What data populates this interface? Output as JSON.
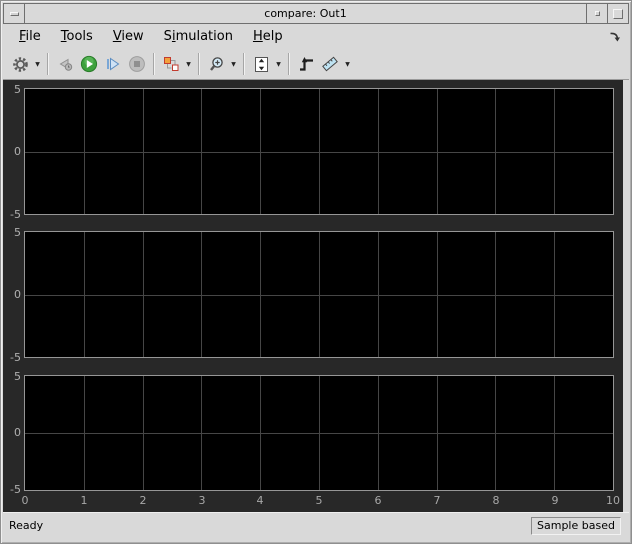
{
  "window": {
    "title": "compare: Out1"
  },
  "titlebar": {
    "buttons": [
      {
        "name": "window-menu",
        "icon": "dash-icon"
      },
      {
        "name": "minimize",
        "icon": "dot-icon"
      },
      {
        "name": "maximize",
        "icon": "square-icon"
      }
    ]
  },
  "menu": {
    "items": [
      {
        "label": "File",
        "pre": "",
        "u": "F",
        "post": "ile"
      },
      {
        "label": "Tools",
        "pre": "",
        "u": "T",
        "post": "ools"
      },
      {
        "label": "View",
        "pre": "",
        "u": "V",
        "post": "iew"
      },
      {
        "label": "Simulation",
        "pre": "S",
        "u": "i",
        "post": "mulation"
      },
      {
        "label": "Help",
        "pre": "",
        "u": "H",
        "post": "elp"
      }
    ],
    "dock_icon": "dock-arrow-icon"
  },
  "toolbar": {
    "buttons": [
      {
        "name": "settings",
        "icon": "gear-icon",
        "dropdown": true,
        "disabled": false
      },
      {
        "name": "step-back",
        "icon": "step-back-icon",
        "dropdown": false,
        "disabled": true
      },
      {
        "name": "run",
        "icon": "play-icon",
        "dropdown": false,
        "disabled": false
      },
      {
        "name": "step-forward",
        "icon": "step-forward-icon",
        "dropdown": false,
        "disabled": false
      },
      {
        "name": "stop",
        "icon": "stop-icon",
        "dropdown": false,
        "disabled": true
      },
      {
        "name": "signal-selector",
        "icon": "signal-selector-icon",
        "dropdown": true,
        "disabled": false
      },
      {
        "name": "zoom",
        "icon": "zoom-in-icon",
        "dropdown": true,
        "disabled": false
      },
      {
        "name": "fit-to-view",
        "icon": "fit-to-view-icon",
        "dropdown": true,
        "disabled": false
      },
      {
        "name": "trigger",
        "icon": "trigger-icon",
        "dropdown": false,
        "disabled": false
      },
      {
        "name": "cursor-measurements",
        "icon": "ruler-icon",
        "dropdown": true,
        "disabled": false
      }
    ]
  },
  "scope": {
    "x_ticks": [
      "0",
      "1",
      "2",
      "3",
      "4",
      "5",
      "6",
      "7",
      "8",
      "9",
      "10"
    ],
    "plots": [
      {
        "y_ticks": [
          "5",
          "0",
          "-5"
        ]
      },
      {
        "y_ticks": [
          "5",
          "0",
          "-5"
        ]
      },
      {
        "y_ticks": [
          "5",
          "0",
          "-5"
        ]
      }
    ],
    "colors": {
      "canvas": "#282828",
      "plot_background": "#000000",
      "grid": "#464646",
      "tick_label": "#b0b0b0",
      "axis_frame": "#969696",
      "play_green": "#3da13d",
      "step_blue": "#cfe2f5",
      "selector_orange": "#f2a13c"
    }
  },
  "statusbar": {
    "left": "Ready",
    "right": "Sample based"
  },
  "chart_data": [
    {
      "type": "line",
      "title": "",
      "xlabel": "",
      "ylabel": "",
      "x_range": [
        0,
        10
      ],
      "y_range": [
        -5,
        5
      ],
      "x_ticks": [
        0,
        1,
        2,
        3,
        4,
        5,
        6,
        7,
        8,
        9,
        10
      ],
      "y_ticks": [
        5,
        0,
        -5
      ],
      "grid": true,
      "series": []
    },
    {
      "type": "line",
      "title": "",
      "xlabel": "",
      "ylabel": "",
      "x_range": [
        0,
        10
      ],
      "y_range": [
        -5,
        5
      ],
      "x_ticks": [
        0,
        1,
        2,
        3,
        4,
        5,
        6,
        7,
        8,
        9,
        10
      ],
      "y_ticks": [
        5,
        0,
        -5
      ],
      "grid": true,
      "series": []
    },
    {
      "type": "line",
      "title": "",
      "xlabel": "",
      "ylabel": "",
      "x_range": [
        0,
        10
      ],
      "y_range": [
        -5,
        5
      ],
      "x_ticks": [
        0,
        1,
        2,
        3,
        4,
        5,
        6,
        7,
        8,
        9,
        10
      ],
      "y_ticks": [
        5,
        0,
        -5
      ],
      "grid": true,
      "series": []
    }
  ]
}
